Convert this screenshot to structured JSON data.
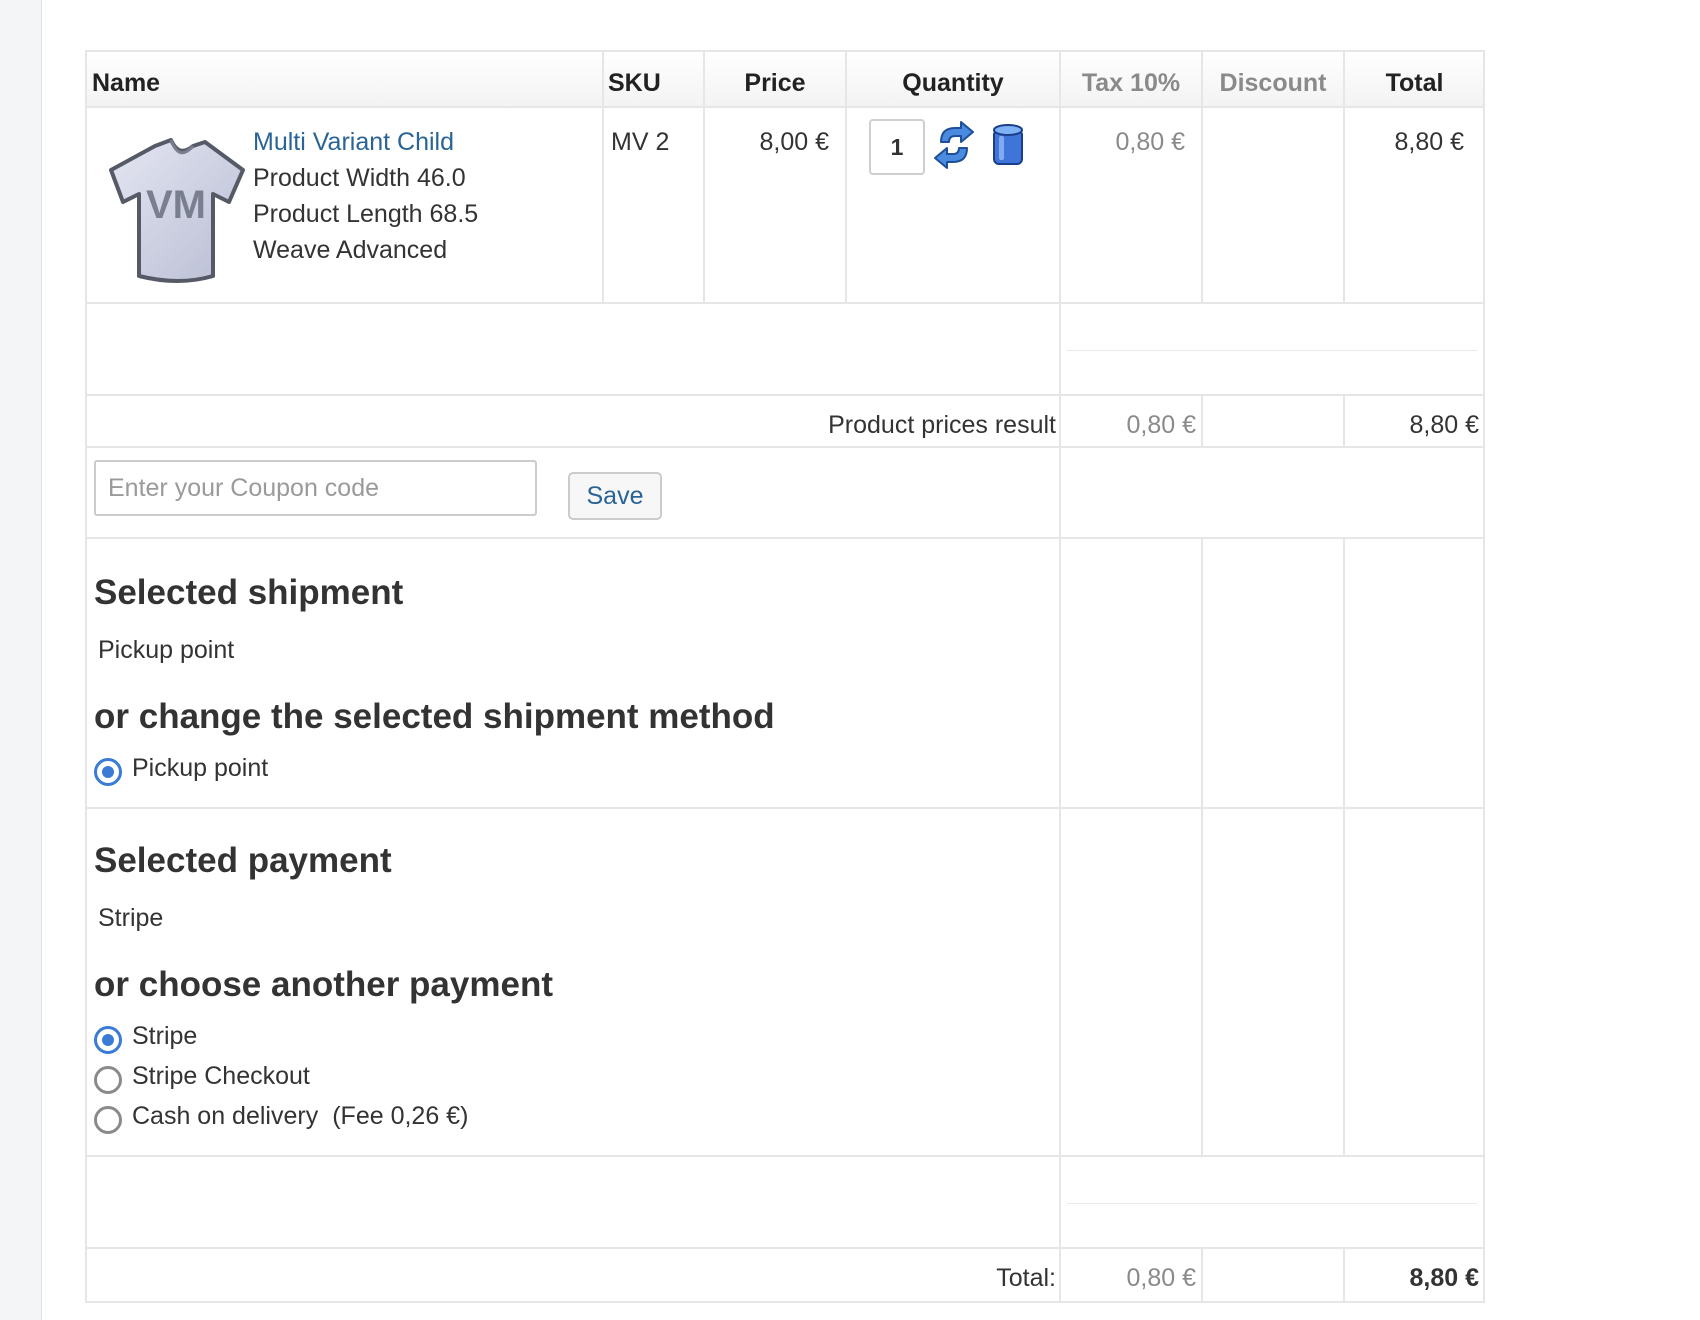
{
  "columns": {
    "name": "Name",
    "sku": "SKU",
    "price": "Price",
    "quantity": "Quantity",
    "tax": "Tax 10%",
    "discount": "Discount",
    "total": "Total"
  },
  "product": {
    "name": "Multi Variant Child",
    "attributes": [
      "Product Width 46.0",
      "Product Length 68.5",
      "Weave Advanced"
    ],
    "sku": "MV 2",
    "price": "8,00 €",
    "quantity": "1",
    "tax": "0,80 €",
    "discount": "",
    "total": "8,80 €",
    "thumbnail_text": "VM"
  },
  "product_prices_result": {
    "label": "Product prices result",
    "tax": "0,80 €",
    "total": "8,80 €"
  },
  "coupon": {
    "placeholder": "Enter your Coupon code",
    "save_label": "Save"
  },
  "shipment": {
    "title": "Selected shipment",
    "selected": "Pickup point",
    "change_title": "or change the selected shipment method",
    "options": [
      {
        "label": "Pickup point",
        "fee": "",
        "checked": true
      }
    ]
  },
  "payment": {
    "title": "Selected payment",
    "selected": "Stripe",
    "change_title": "or choose another payment",
    "options": [
      {
        "label": "Stripe",
        "fee": "",
        "checked": true
      },
      {
        "label": "Stripe Checkout",
        "fee": "",
        "checked": false
      },
      {
        "label": "Cash on delivery",
        "fee": "(Fee 0,26 €)",
        "checked": false
      }
    ]
  },
  "total_row": {
    "label": "Total:",
    "tax": "0,80 €",
    "total": "8,80 €"
  },
  "colors": {
    "link": "#2a6496",
    "radio_accent": "#3a7bd5",
    "border": "#e6e6e6"
  }
}
